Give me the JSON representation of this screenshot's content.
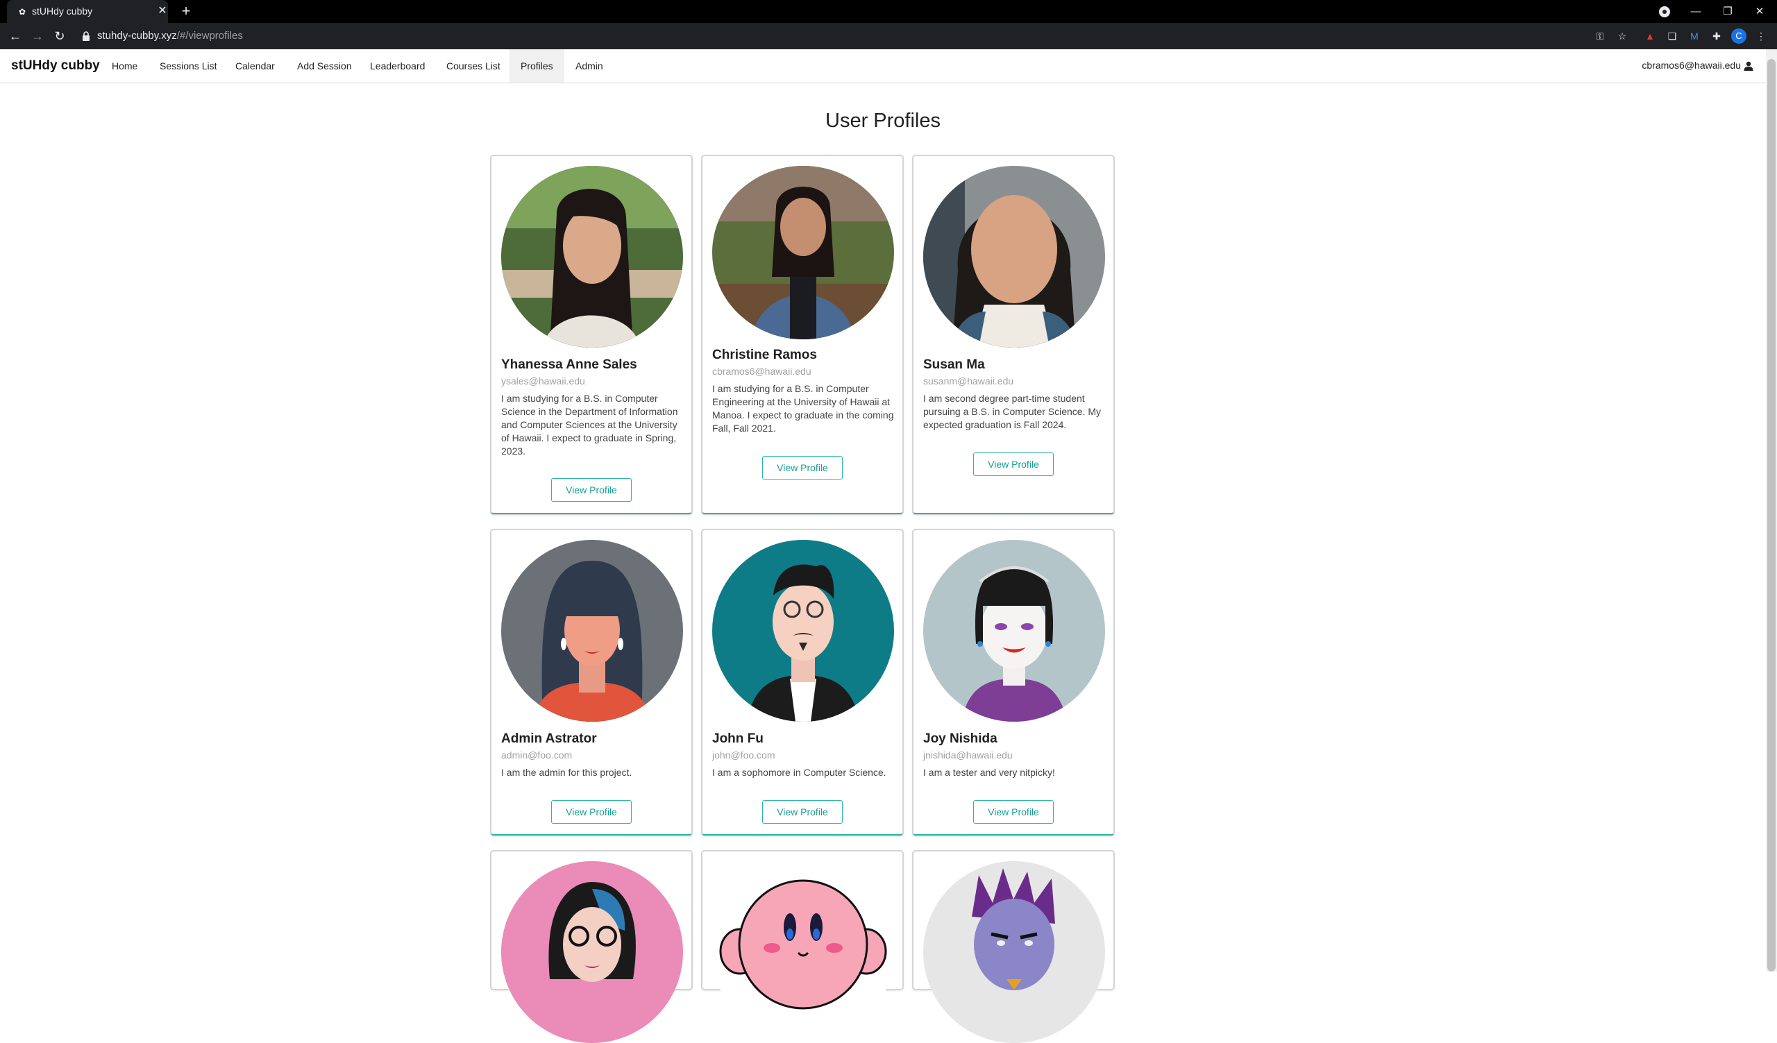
{
  "browser": {
    "tab_title": "stUHdy cubby",
    "url_host": "stuhdy-cubby.xyz",
    "url_path": "/#/viewprofiles",
    "profile_initial": "C",
    "window_controls": [
      "minimize-icon",
      "restore-icon",
      "close-icon"
    ]
  },
  "navbar": {
    "brand": "stUHdy cubby",
    "items": [
      {
        "label": "Home"
      },
      {
        "label": "Sessions List"
      },
      {
        "label": "Calendar"
      },
      {
        "label": "Add Session"
      },
      {
        "label": "Leaderboard"
      },
      {
        "label": "Courses List"
      },
      {
        "label": "Profiles",
        "active": true
      },
      {
        "label": "Admin"
      }
    ],
    "user_email": "cbramos6@hawaii.edu"
  },
  "page": {
    "title": "User Profiles",
    "view_profile_label": "View Profile",
    "accent_color": "#2cb6a8"
  },
  "profiles": [
    {
      "name": "Yhanessa Anne Sales",
      "email": "ysales@hawaii.edu",
      "description": "I am studying for a B.S. in Computer Science in the Department of Information and Computer Sciences at the University of Hawaii. I expect to graduate in Spring, 2023."
    },
    {
      "name": "Christine Ramos",
      "email": "cbramos6@hawaii.edu",
      "description": "I am studying for a B.S. in Computer Engineering at the University of Hawaii at Manoa. I expect to graduate in the coming Fall, Fall 2021."
    },
    {
      "name": "Susan Ma",
      "email": "susanm@hawaii.edu",
      "description": "I am second degree part-time student pursuing a B.S. in Computer Science. My expected graduation is Fall 2024."
    },
    {
      "name": "Admin Astrator",
      "email": "admin@foo.com",
      "description": "I am the admin for this project."
    },
    {
      "name": "John Fu",
      "email": "john@foo.com",
      "description": "I am a sophomore in Computer Science."
    },
    {
      "name": "Joy Nishida",
      "email": "jnishida@hawaii.edu",
      "description": "I am a tester and very nitpicky!"
    }
  ]
}
